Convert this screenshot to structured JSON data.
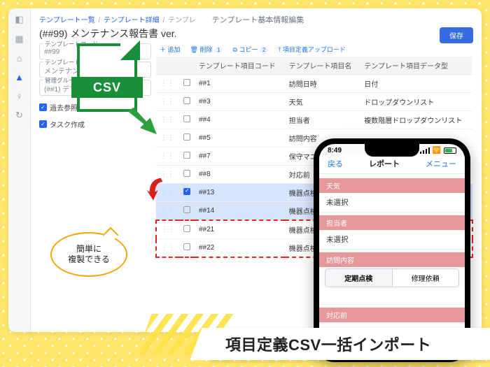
{
  "breadcrumb": {
    "a": "テンプレート一覧",
    "b": "テンプレート詳細",
    "c": "テンプレ"
  },
  "subtitle": "テンプレート基本情報編集",
  "title": "(##99) メンテナンス報告書 ver.",
  "save_label": "保存",
  "fields": {
    "code_label": "テンプレートコード",
    "code_value": "##99",
    "name_label": "テンプレート名",
    "name_value": "メンテナンス",
    "group_label": "管理グループ",
    "group_value": "(##1) デフォルトグループ"
  },
  "checkboxes": {
    "past": "過去参照",
    "task": "タスク作成"
  },
  "toolbar": {
    "add": "追加",
    "del": "削除",
    "del_badge": "1",
    "copy": "コピー",
    "copy_badge": "2",
    "upload": "項目定義アップロード"
  },
  "thead": {
    "code": "テンプレート項目コード",
    "name": "テンプレート項目名",
    "type": "テンプレート項目データ型"
  },
  "rows": [
    {
      "code": "##1",
      "name": "訪問日時",
      "type": "日付",
      "chk": false,
      "hl": false,
      "new": false
    },
    {
      "code": "##3",
      "name": "天気",
      "type": "ドロップダウンリスト",
      "chk": false,
      "hl": false,
      "new": false
    },
    {
      "code": "##4",
      "name": "担当者",
      "type": "複数階層ドロップダウンリスト",
      "chk": false,
      "hl": false,
      "new": false
    },
    {
      "code": "##5",
      "name": "訪問内容",
      "type": "",
      "chk": false,
      "hl": false,
      "new": false
    },
    {
      "code": "##7",
      "name": "保守マニュアル確認",
      "type": "",
      "chk": false,
      "hl": false,
      "new": false
    },
    {
      "code": "##8",
      "name": "対応前",
      "type": "",
      "chk": false,
      "hl": false,
      "new": false
    },
    {
      "code": "##13",
      "name": "機器点検A",
      "type": "",
      "chk": true,
      "hl": true,
      "new": false
    },
    {
      "code": "##14",
      "name": "機器点検A 備考",
      "type": "",
      "chk": false,
      "hl": true,
      "new": false
    },
    {
      "code": "##21",
      "name": "機器点検B",
      "type": "",
      "chk": false,
      "hl": false,
      "new": true
    },
    {
      "code": "##22",
      "name": "機器点検B 備考",
      "type": "",
      "chk": false,
      "hl": false,
      "new": true
    }
  ],
  "csv_badge": "CSV",
  "bubble": "簡単に\n複製できる",
  "phone": {
    "time": "8:49",
    "back": "戻る",
    "title": "レポート",
    "menu": "メニュー",
    "sections": [
      {
        "head": "天気",
        "value": "未選択"
      },
      {
        "head": "担当者",
        "value": "未選択"
      }
    ],
    "content_head": "訪問内容",
    "tabs": {
      "a": "定期点検",
      "b": "修理依頼"
    },
    "footer_row": "対応前"
  },
  "caption": "項目定義CSV一括インポート"
}
